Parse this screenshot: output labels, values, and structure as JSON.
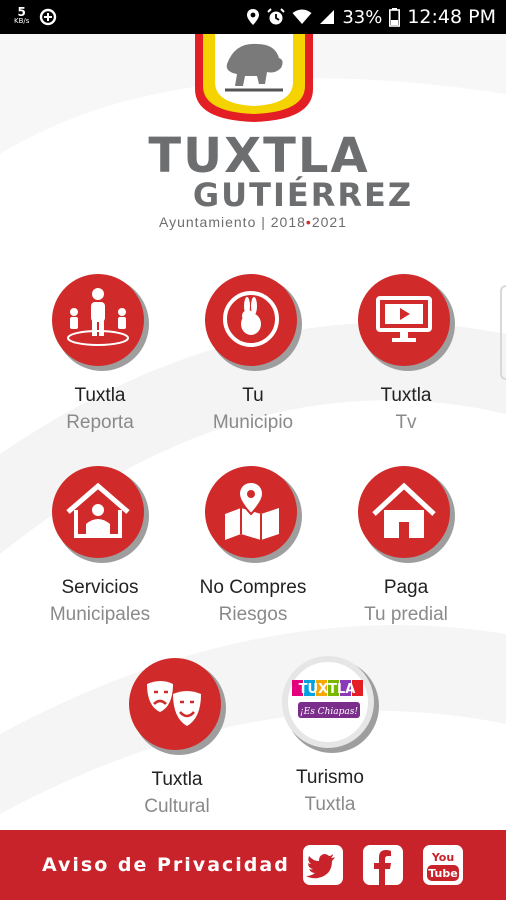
{
  "status_bar": {
    "net_speed": "5",
    "net_unit": "KB/s",
    "battery": "33%",
    "time": "12:48 PM"
  },
  "logo": {
    "title": "TUXTLA",
    "subtitle": "GUTIÉRREZ",
    "tagline_prefix": "Ayuntamiento | 2018",
    "tagline_sep": "•",
    "tagline_suffix": "2021"
  },
  "menu": [
    {
      "line1": "Tuxtla",
      "line2": "Reporta",
      "icon": "people-icon"
    },
    {
      "line1": "Tu",
      "line2": "Municipio",
      "icon": "rabbit-icon"
    },
    {
      "line1": "Tuxtla",
      "line2": "Tv",
      "icon": "tv-play-icon"
    },
    {
      "line1": "Servicios",
      "line2": "Municipales",
      "icon": "house-person-icon"
    },
    {
      "line1": "No Compres",
      "line2": "Riesgos",
      "icon": "map-pin-icon"
    },
    {
      "line1": "Paga",
      "line2": "Tu predial",
      "icon": "house-icon"
    },
    {
      "line1": "Tuxtla",
      "line2": "Cultural",
      "icon": "theater-masks-icon"
    },
    {
      "line1": "Turismo",
      "line2": "Tuxtla",
      "icon": "tuxtla-brand-logo"
    }
  ],
  "turismo_logo": {
    "brand": "TUXTLA",
    "slogan": "¡Es Chiapas!"
  },
  "footer": {
    "privacy_label": "Aviso de Privacidad",
    "youtube_top": "You",
    "youtube_bottom": "Tube"
  },
  "colors": {
    "brand_red": "#c8222a",
    "icon_red": "#d12a2a",
    "logo_gray": "#6d6e70",
    "shield_yellow": "#f5d300"
  }
}
